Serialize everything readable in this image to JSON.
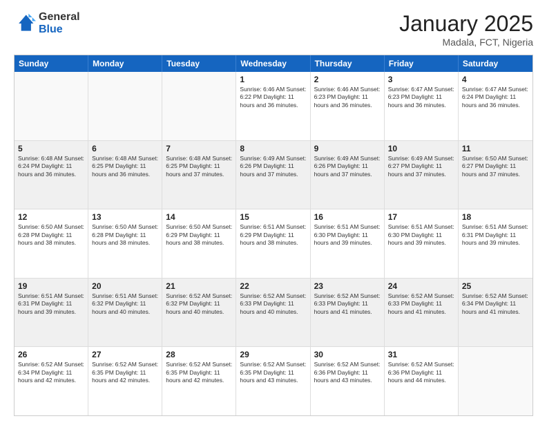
{
  "header": {
    "logo_general": "General",
    "logo_blue": "Blue",
    "month_title": "January 2025",
    "location": "Madala, FCT, Nigeria"
  },
  "days_of_week": [
    "Sunday",
    "Monday",
    "Tuesday",
    "Wednesday",
    "Thursday",
    "Friday",
    "Saturday"
  ],
  "weeks": [
    [
      {
        "day": "",
        "text": ""
      },
      {
        "day": "",
        "text": ""
      },
      {
        "day": "",
        "text": ""
      },
      {
        "day": "1",
        "text": "Sunrise: 6:46 AM\nSunset: 6:22 PM\nDaylight: 11 hours\nand 36 minutes."
      },
      {
        "day": "2",
        "text": "Sunrise: 6:46 AM\nSunset: 6:23 PM\nDaylight: 11 hours\nand 36 minutes."
      },
      {
        "day": "3",
        "text": "Sunrise: 6:47 AM\nSunset: 6:23 PM\nDaylight: 11 hours\nand 36 minutes."
      },
      {
        "day": "4",
        "text": "Sunrise: 6:47 AM\nSunset: 6:24 PM\nDaylight: 11 hours\nand 36 minutes."
      }
    ],
    [
      {
        "day": "5",
        "text": "Sunrise: 6:48 AM\nSunset: 6:24 PM\nDaylight: 11 hours\nand 36 minutes."
      },
      {
        "day": "6",
        "text": "Sunrise: 6:48 AM\nSunset: 6:25 PM\nDaylight: 11 hours\nand 36 minutes."
      },
      {
        "day": "7",
        "text": "Sunrise: 6:48 AM\nSunset: 6:25 PM\nDaylight: 11 hours\nand 37 minutes."
      },
      {
        "day": "8",
        "text": "Sunrise: 6:49 AM\nSunset: 6:26 PM\nDaylight: 11 hours\nand 37 minutes."
      },
      {
        "day": "9",
        "text": "Sunrise: 6:49 AM\nSunset: 6:26 PM\nDaylight: 11 hours\nand 37 minutes."
      },
      {
        "day": "10",
        "text": "Sunrise: 6:49 AM\nSunset: 6:27 PM\nDaylight: 11 hours\nand 37 minutes."
      },
      {
        "day": "11",
        "text": "Sunrise: 6:50 AM\nSunset: 6:27 PM\nDaylight: 11 hours\nand 37 minutes."
      }
    ],
    [
      {
        "day": "12",
        "text": "Sunrise: 6:50 AM\nSunset: 6:28 PM\nDaylight: 11 hours\nand 38 minutes."
      },
      {
        "day": "13",
        "text": "Sunrise: 6:50 AM\nSunset: 6:28 PM\nDaylight: 11 hours\nand 38 minutes."
      },
      {
        "day": "14",
        "text": "Sunrise: 6:50 AM\nSunset: 6:29 PM\nDaylight: 11 hours\nand 38 minutes."
      },
      {
        "day": "15",
        "text": "Sunrise: 6:51 AM\nSunset: 6:29 PM\nDaylight: 11 hours\nand 38 minutes."
      },
      {
        "day": "16",
        "text": "Sunrise: 6:51 AM\nSunset: 6:30 PM\nDaylight: 11 hours\nand 39 minutes."
      },
      {
        "day": "17",
        "text": "Sunrise: 6:51 AM\nSunset: 6:30 PM\nDaylight: 11 hours\nand 39 minutes."
      },
      {
        "day": "18",
        "text": "Sunrise: 6:51 AM\nSunset: 6:31 PM\nDaylight: 11 hours\nand 39 minutes."
      }
    ],
    [
      {
        "day": "19",
        "text": "Sunrise: 6:51 AM\nSunset: 6:31 PM\nDaylight: 11 hours\nand 39 minutes."
      },
      {
        "day": "20",
        "text": "Sunrise: 6:51 AM\nSunset: 6:32 PM\nDaylight: 11 hours\nand 40 minutes."
      },
      {
        "day": "21",
        "text": "Sunrise: 6:52 AM\nSunset: 6:32 PM\nDaylight: 11 hours\nand 40 minutes."
      },
      {
        "day": "22",
        "text": "Sunrise: 6:52 AM\nSunset: 6:33 PM\nDaylight: 11 hours\nand 40 minutes."
      },
      {
        "day": "23",
        "text": "Sunrise: 6:52 AM\nSunset: 6:33 PM\nDaylight: 11 hours\nand 41 minutes."
      },
      {
        "day": "24",
        "text": "Sunrise: 6:52 AM\nSunset: 6:33 PM\nDaylight: 11 hours\nand 41 minutes."
      },
      {
        "day": "25",
        "text": "Sunrise: 6:52 AM\nSunset: 6:34 PM\nDaylight: 11 hours\nand 41 minutes."
      }
    ],
    [
      {
        "day": "26",
        "text": "Sunrise: 6:52 AM\nSunset: 6:34 PM\nDaylight: 11 hours\nand 42 minutes."
      },
      {
        "day": "27",
        "text": "Sunrise: 6:52 AM\nSunset: 6:35 PM\nDaylight: 11 hours\nand 42 minutes."
      },
      {
        "day": "28",
        "text": "Sunrise: 6:52 AM\nSunset: 6:35 PM\nDaylight: 11 hours\nand 42 minutes."
      },
      {
        "day": "29",
        "text": "Sunrise: 6:52 AM\nSunset: 6:35 PM\nDaylight: 11 hours\nand 43 minutes."
      },
      {
        "day": "30",
        "text": "Sunrise: 6:52 AM\nSunset: 6:36 PM\nDaylight: 11 hours\nand 43 minutes."
      },
      {
        "day": "31",
        "text": "Sunrise: 6:52 AM\nSunset: 6:36 PM\nDaylight: 11 hours\nand 44 minutes."
      },
      {
        "day": "",
        "text": ""
      }
    ]
  ]
}
